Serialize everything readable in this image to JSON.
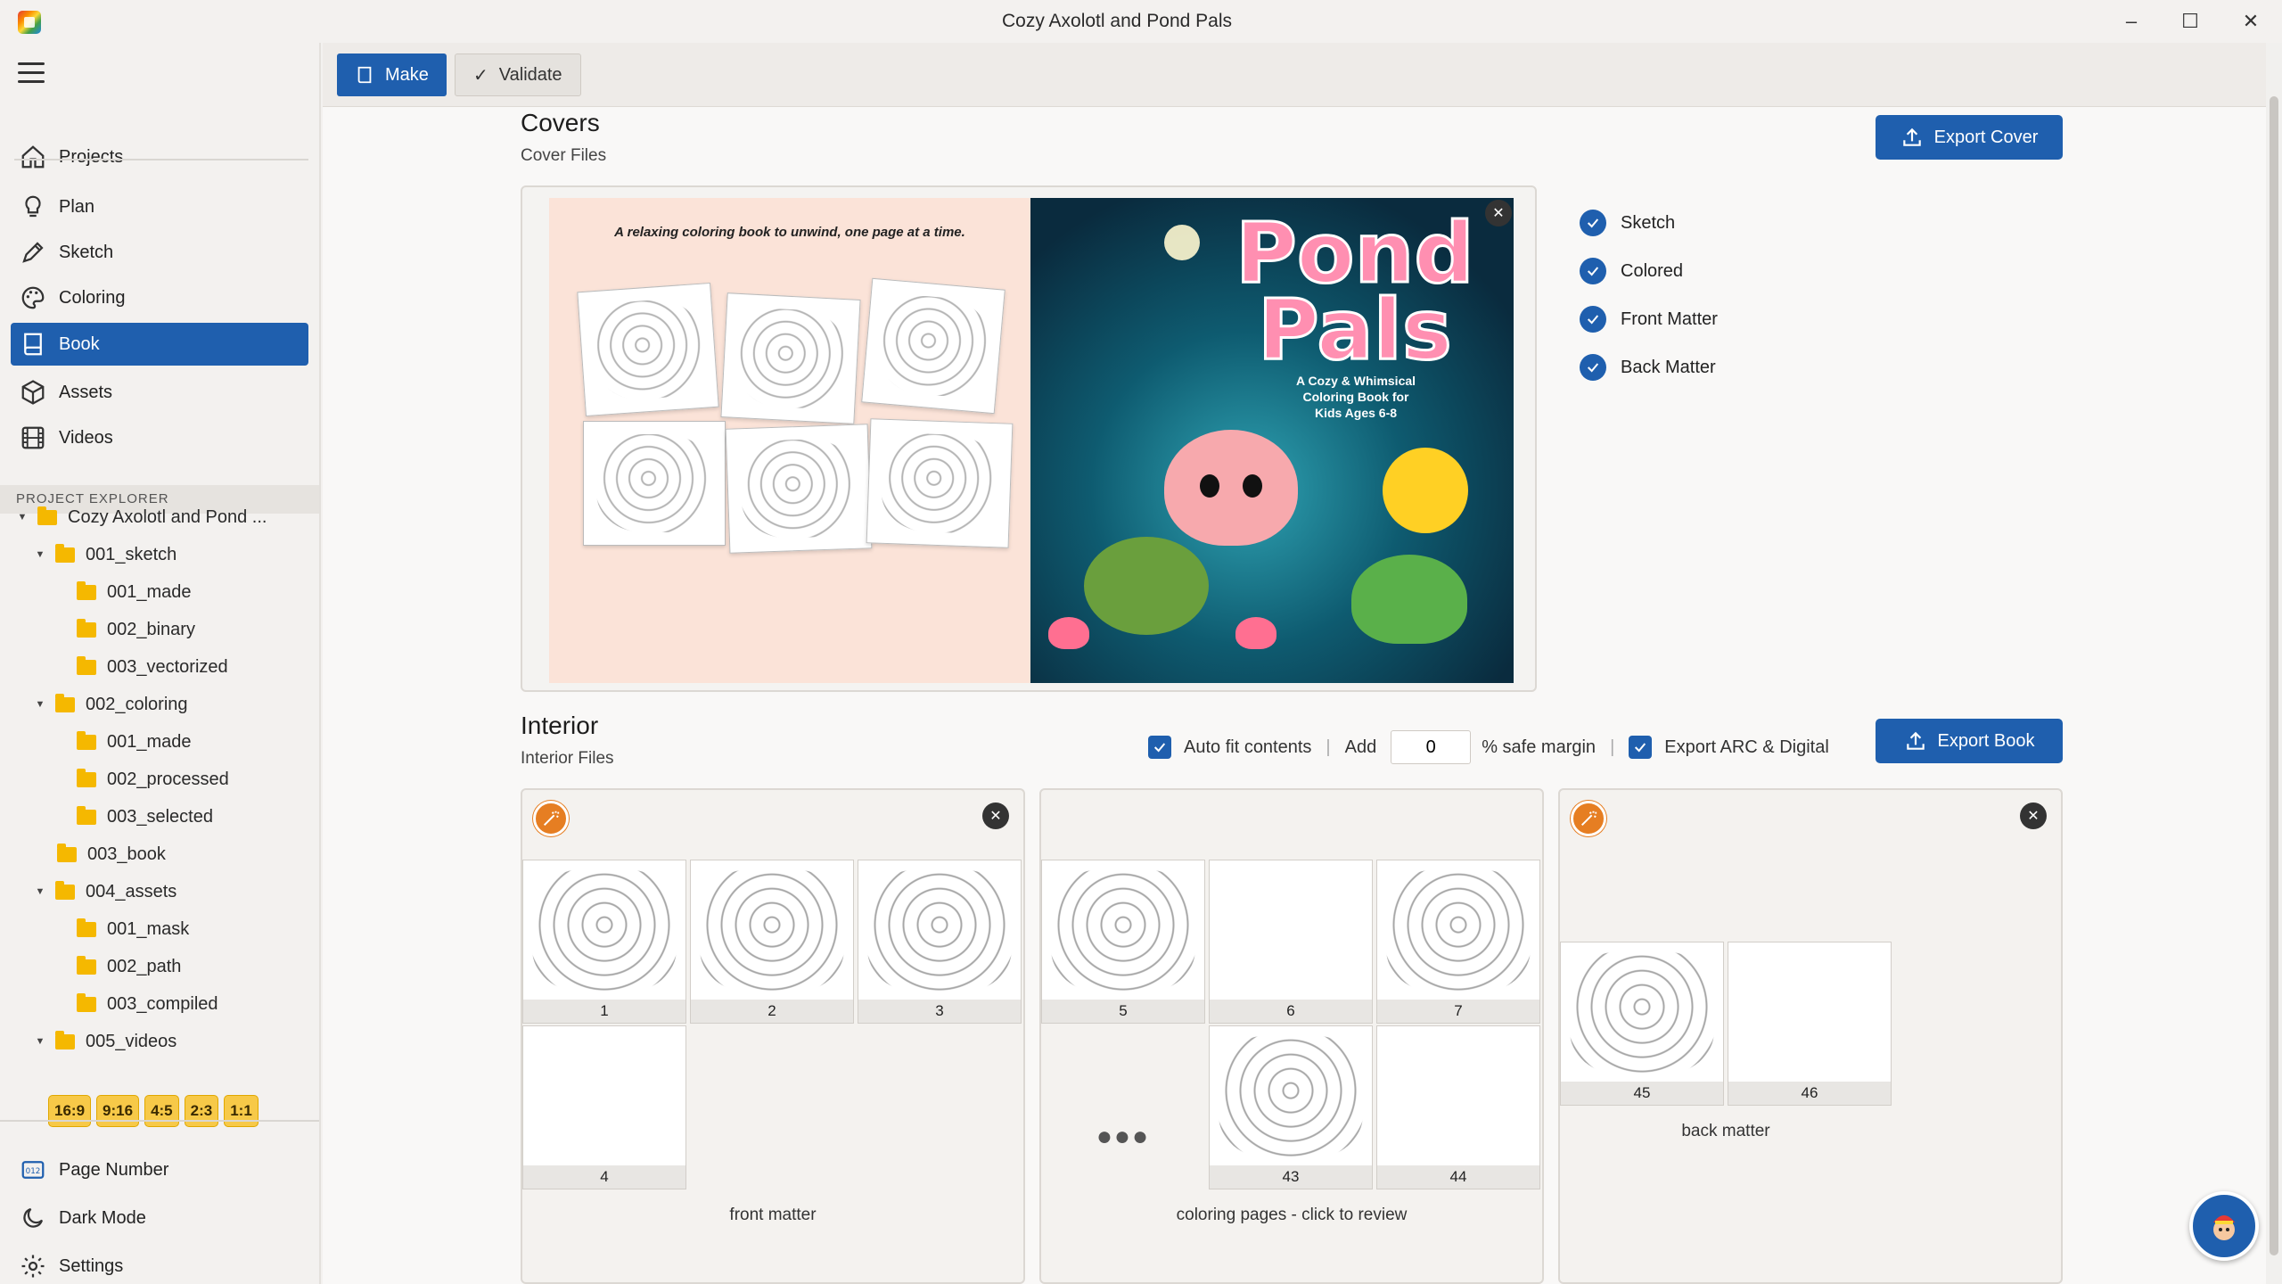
{
  "window": {
    "title": "Cozy Axolotl and Pond Pals"
  },
  "toolbar": {
    "make_label": "Make",
    "validate_label": "Validate"
  },
  "nav": {
    "items": [
      {
        "label": "Projects",
        "icon": "home-icon"
      },
      {
        "label": "Plan",
        "icon": "lightbulb-icon"
      },
      {
        "label": "Sketch",
        "icon": "pen-icon"
      },
      {
        "label": "Coloring",
        "icon": "palette-icon"
      },
      {
        "label": "Book",
        "icon": "book-icon",
        "active": true
      },
      {
        "label": "Assets",
        "icon": "cube-icon"
      },
      {
        "label": "Videos",
        "icon": "film-icon"
      }
    ],
    "bottom": [
      {
        "label": "Page Number",
        "icon": "page-number-icon"
      },
      {
        "label": "Dark Mode",
        "icon": "moon-icon"
      },
      {
        "label": "Settings",
        "icon": "gear-icon"
      }
    ]
  },
  "explorer": {
    "header": "PROJECT EXPLORER",
    "tree": [
      {
        "label": "Cozy Axolotl and Pond ...",
        "caret": true
      },
      {
        "label": "001_sketch",
        "caret": true
      },
      {
        "label": "001_made"
      },
      {
        "label": "002_binary"
      },
      {
        "label": "003_vectorized"
      },
      {
        "label": "002_coloring",
        "caret": true
      },
      {
        "label": "001_made"
      },
      {
        "label": "002_processed"
      },
      {
        "label": "003_selected"
      },
      {
        "label": "003_book"
      },
      {
        "label": "004_assets",
        "caret": true
      },
      {
        "label": "001_mask"
      },
      {
        "label": "002_path"
      },
      {
        "label": "003_compiled"
      },
      {
        "label": "005_videos",
        "caret": true
      }
    ],
    "ratios": [
      "16:9",
      "9:16",
      "4:5",
      "2:3",
      "1:1"
    ]
  },
  "covers": {
    "title": "Covers",
    "subtitle": "Cover Files",
    "export_label": "Export Cover",
    "back_tagline": "A relaxing coloring book to unwind, one page at a time.",
    "front_title_line1": "Pond",
    "front_title_line2": "Pals",
    "front_subtitle": "A Cozy & Whimsical Coloring Book for Kids Ages 6-8",
    "checks": [
      "Sketch",
      "Colored",
      "Front Matter",
      "Back Matter"
    ]
  },
  "interior": {
    "title": "Interior",
    "subtitle": "Interior Files",
    "auto_fit_label": "Auto fit contents",
    "add_label": "Add",
    "safe_margin_value": "0",
    "safe_margin_label": "% safe margin",
    "export_arc_label": "Export ARC & Digital",
    "export_book_label": "Export Book",
    "front_matter": {
      "caption": "front matter",
      "pages": [
        "1",
        "2",
        "3",
        "4"
      ]
    },
    "coloring_pages": {
      "caption": "coloring pages - click to review",
      "pages": [
        "5",
        "6",
        "7",
        "43",
        "44"
      ],
      "ellipsis": "●●●"
    },
    "back_matter": {
      "caption": "back matter",
      "pages": [
        "45",
        "46"
      ]
    }
  },
  "colors": {
    "accent": "#1f5fae",
    "folder": "#f5b800",
    "wand": "#e67e22",
    "ratio_chip": "#f7c948"
  }
}
